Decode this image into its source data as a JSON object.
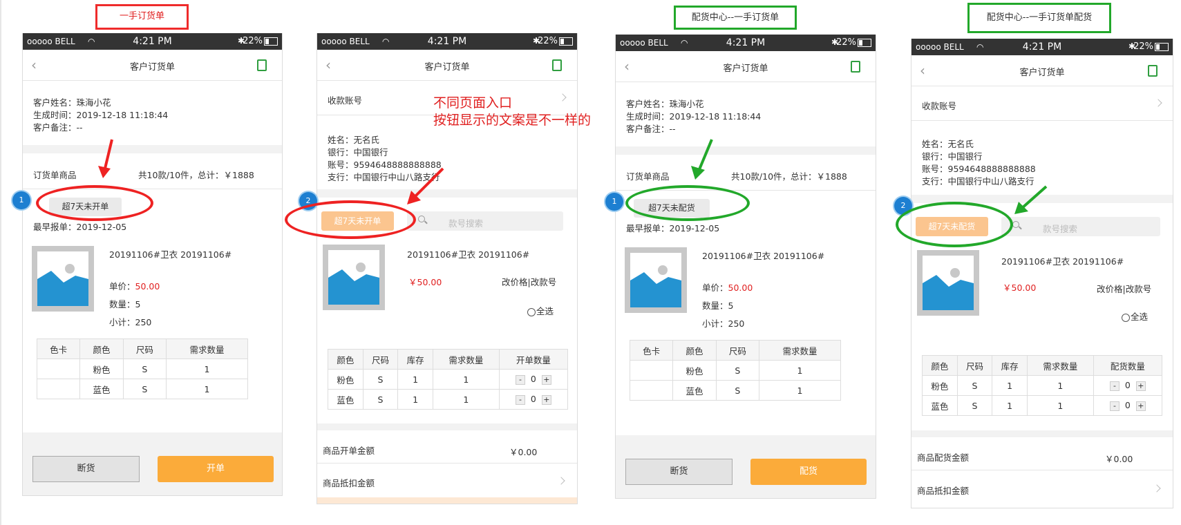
{
  "labels": {
    "p1": "一手订货单",
    "p3": "配货中心--一手订货单",
    "p4": "配货中心--一手订货单配货"
  },
  "note": {
    "line1": "不同页面入口",
    "line2": "按钮显示的文案是不一样的"
  },
  "status": {
    "carrier": "ooooo BELL",
    "time": "4:21 PM",
    "battery": "22%"
  },
  "nav": {
    "title": "客户订货单"
  },
  "customer": {
    "name": "客户姓名：珠海小花",
    "created": "生成时间：2019-12-18 11:18:44",
    "remark": "客户备注：--"
  },
  "account": {
    "label": "收款账号",
    "name": "姓名：无名氏",
    "bank": "银行：中国银行",
    "number": "账号：9594648888888888",
    "branch": "支行：中国银行中山八路支行"
  },
  "goods": {
    "label": "订货单商品",
    "summary": "共10款/10件，总计：￥1888"
  },
  "filters": {
    "open": "超7天未开单",
    "dist": "超7天未配货"
  },
  "earliest": "最早报单：2019-12-05",
  "search": {
    "placeholder": "款号搜索"
  },
  "product": {
    "name": "20191106#卫衣 20191106#",
    "price_label": "单价：",
    "price": "50.00",
    "price_alt": "￥50.00",
    "qty": "数量：5",
    "subtotal": "小计：250",
    "edit": "改价格|改款号",
    "select_all": "全选"
  },
  "table_a": {
    "headers": [
      "色卡",
      "颜色",
      "尺码",
      "需求数量"
    ],
    "rows": [
      [
        "",
        "粉色",
        "S",
        "1"
      ],
      [
        "",
        "蓝色",
        "S",
        "1"
      ]
    ]
  },
  "table_b": {
    "headers": [
      "颜色",
      "尺码",
      "库存",
      "需求数量",
      "开单数量"
    ],
    "rows": [
      [
        "粉色",
        "S",
        "1",
        "1",
        "0"
      ],
      [
        "蓝色",
        "S",
        "1",
        "1",
        "0"
      ]
    ]
  },
  "table_c": {
    "headers": [
      "颜色",
      "尺码",
      "库存",
      "需求数量",
      "配货数量"
    ],
    "rows": [
      [
        "粉色",
        "S",
        "1",
        "1",
        "0"
      ],
      [
        "蓝色",
        "S",
        "1",
        "1",
        "0"
      ]
    ]
  },
  "stepper": {
    "minus": "-",
    "plus": "+"
  },
  "amounts": {
    "open_label": "商品开单金额",
    "dist_label": "商品配货金额",
    "value": "￥0.00",
    "deduct_label": "商品抵扣金额"
  },
  "buttons": {
    "stop": "断货",
    "open": "开单",
    "dist": "配货"
  },
  "badges": {
    "one": "1",
    "two": "2"
  },
  "colors": {
    "orange": "#fbab3a",
    "red": "#ee2222",
    "green": "#22a82a",
    "badge": "#1d7fd1"
  }
}
